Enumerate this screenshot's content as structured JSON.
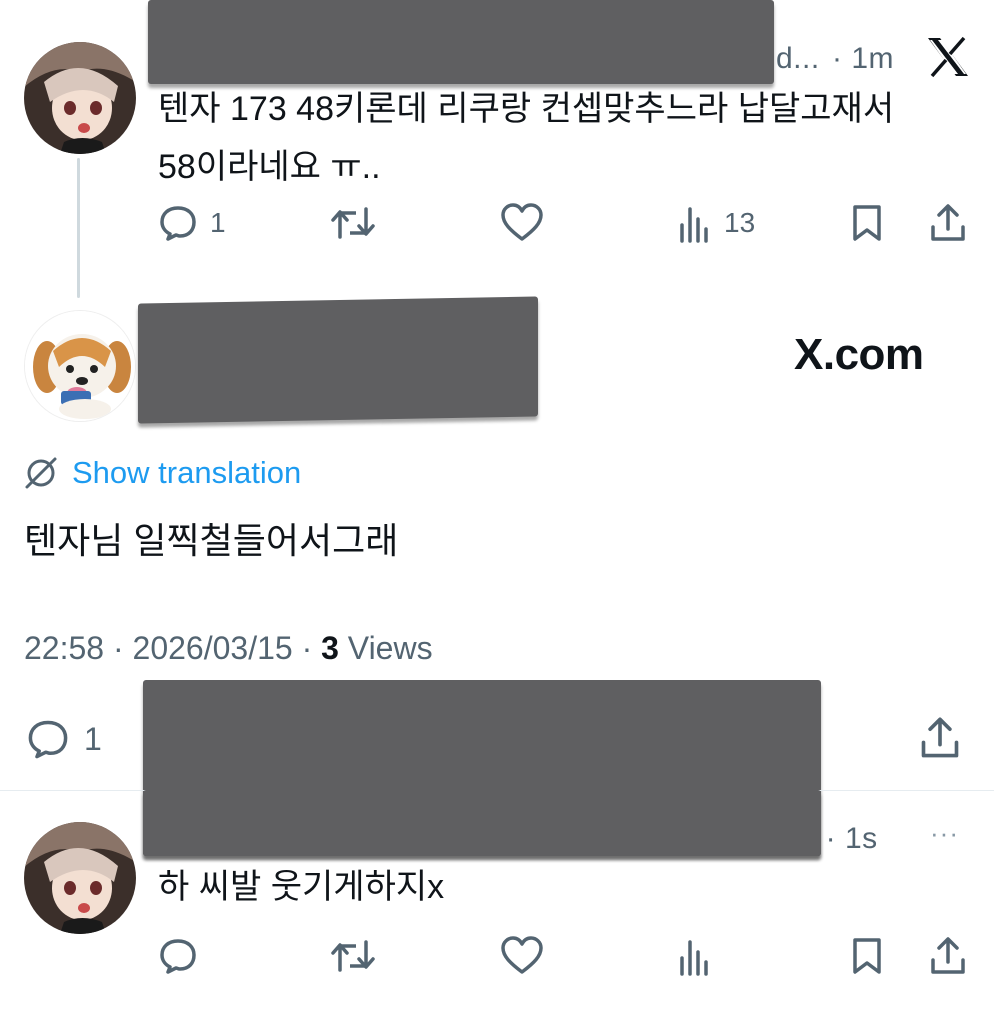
{
  "tweet1": {
    "handle_tail": "d...",
    "time": "· 1m",
    "brand_glyph": "𝕏",
    "text_line1": "텐자 173 48키론데 리쿠랑 컨셉맞추느라 납달고재서",
    "text_line2": "58이라네요 ㅠ..",
    "reply_count": "1",
    "views_count": "13",
    "icons": [
      "reply-icon",
      "retweet-icon",
      "like-icon",
      "views-icon",
      "bookmark-icon",
      "share-icon"
    ]
  },
  "main_tweet": {
    "watermark": "X.com",
    "translate_label": "Show translation",
    "text": "텐자님 일찍철들어서그래",
    "timestamp": "22:58 · 2026/03/15 · ",
    "views_count": "3",
    "views_label": " Views",
    "reply_count": "1"
  },
  "tweet3": {
    "time": ". · 1s",
    "more": "···",
    "text": "하 씨발 웃기게하지x"
  },
  "colors": {
    "accent": "#1d9bf0",
    "muted": "#536471",
    "text": "#0f1419",
    "redaction": "#5f5f61"
  }
}
